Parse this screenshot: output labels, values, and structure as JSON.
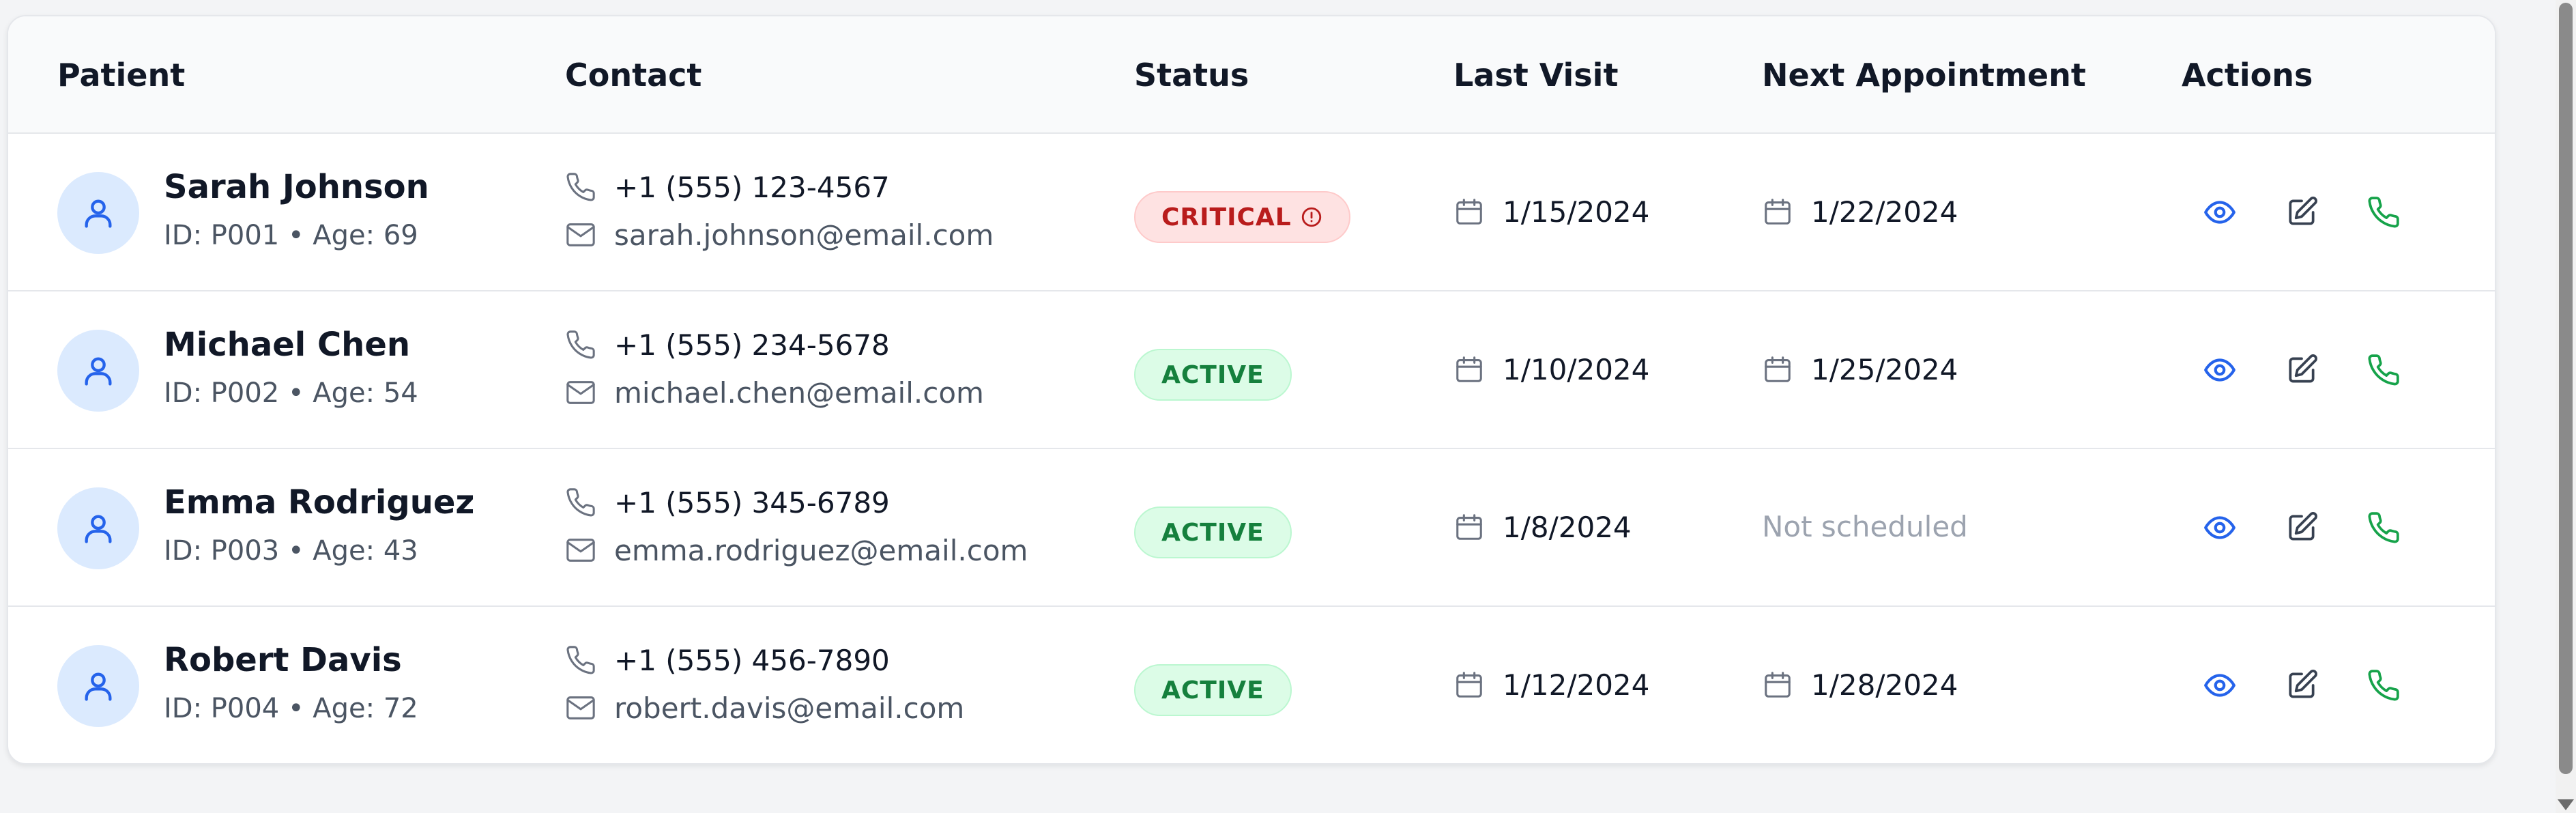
{
  "columns": {
    "patient": "Patient",
    "contact": "Contact",
    "status": "Status",
    "last_visit": "Last Visit",
    "next_appointment": "Next Appointment",
    "actions": "Actions"
  },
  "colors": {
    "accent_blue": "#2563eb",
    "action_green": "#16a34a",
    "critical_red": "#b91c1c",
    "active_green": "#15803d",
    "avatar_bg": "#dbeafe"
  },
  "icons": {
    "avatar": "user-icon",
    "phone": "phone-icon",
    "email": "mail-icon",
    "date": "calendar-icon",
    "critical": "alert-circle-icon",
    "view": "eye-icon",
    "edit": "edit-icon",
    "call": "phone-icon"
  },
  "patients": [
    {
      "name": "Sarah Johnson",
      "meta": "ID: P001 • Age: 69",
      "phone": "+1 (555) 123-4567",
      "email": "sarah.johnson@email.com",
      "status": "CRITICAL",
      "last_visit": "1/15/2024",
      "next_appointment": "1/22/2024"
    },
    {
      "name": "Michael Chen",
      "meta": "ID: P002 • Age: 54",
      "phone": "+1 (555) 234-5678",
      "email": "michael.chen@email.com",
      "status": "ACTIVE",
      "last_visit": "1/10/2024",
      "next_appointment": "1/25/2024"
    },
    {
      "name": "Emma Rodriguez",
      "meta": "ID: P003 • Age: 43",
      "phone": "+1 (555) 345-6789",
      "email": "emma.rodriguez@email.com",
      "status": "ACTIVE",
      "last_visit": "1/8/2024",
      "next_appointment": "Not scheduled"
    },
    {
      "name": "Robert Davis",
      "meta": "ID: P004 • Age: 72",
      "phone": "+1 (555) 456-7890",
      "email": "robert.davis@email.com",
      "status": "ACTIVE",
      "last_visit": "1/12/2024",
      "next_appointment": "1/28/2024"
    }
  ]
}
